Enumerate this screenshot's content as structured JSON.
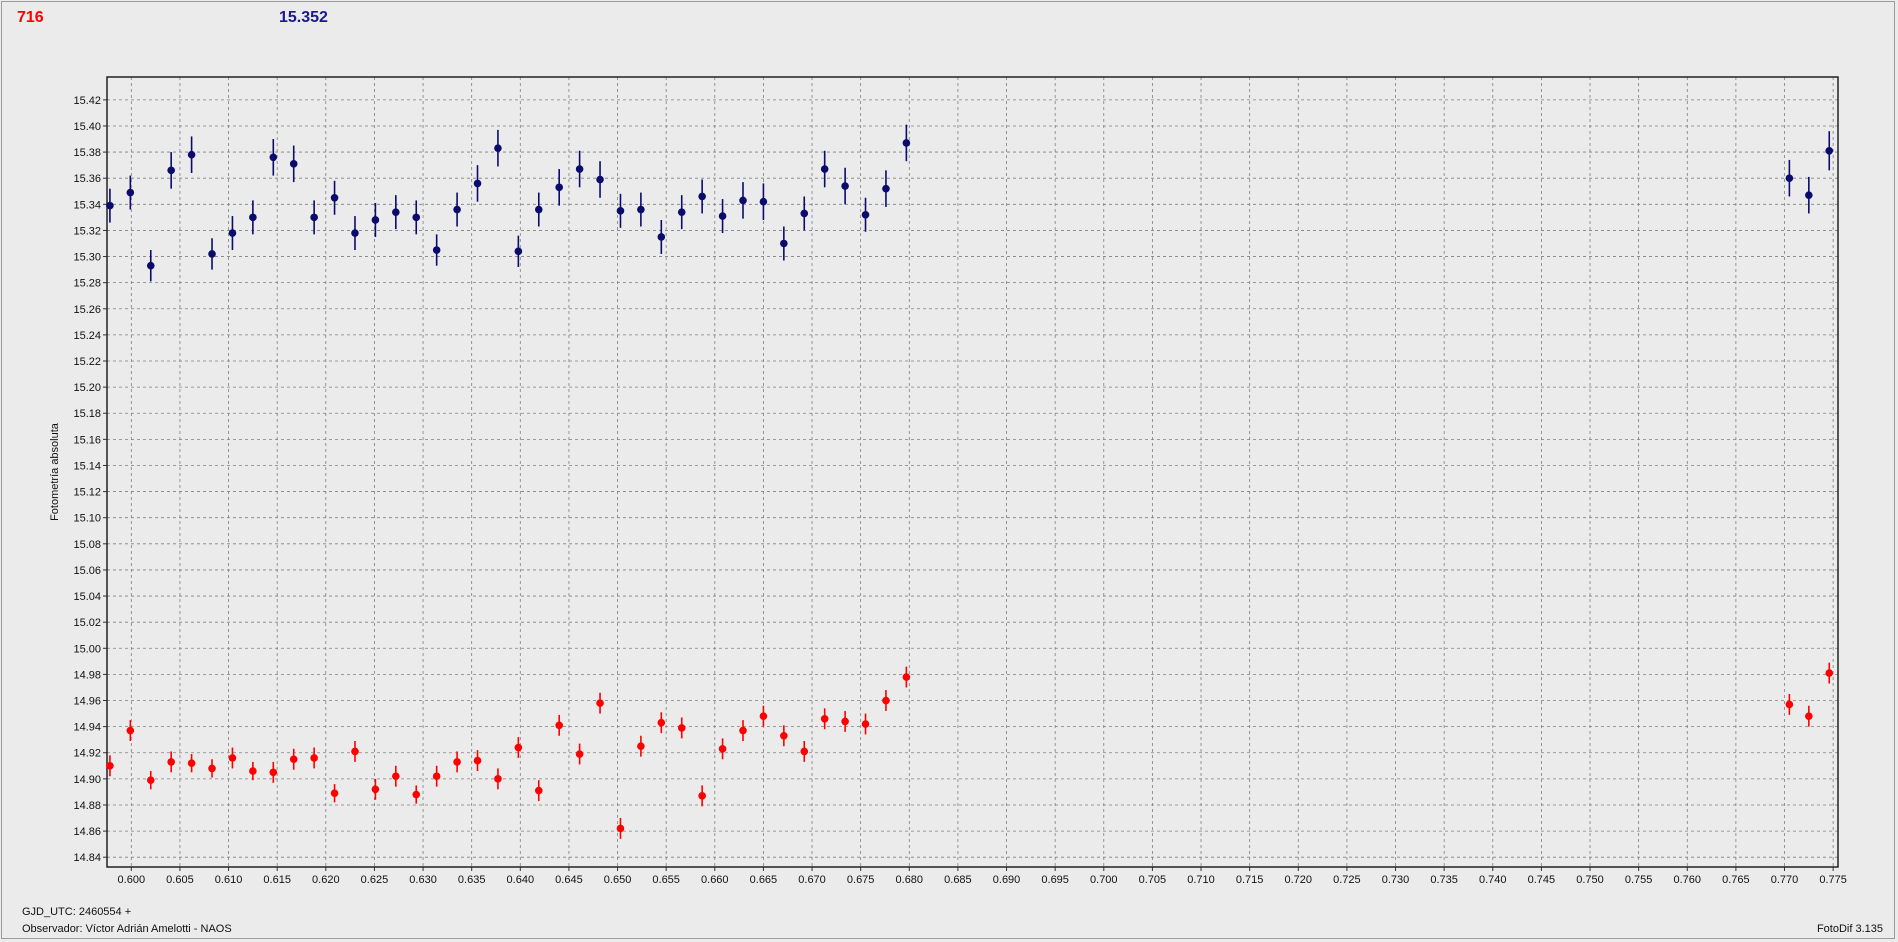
{
  "header": {
    "left_value": "716",
    "mid_value": "15.352"
  },
  "footer": {
    "gjd": "GJD_UTC: 2460554 +",
    "observer": "Observador: Víctor Adrián Amelotti - NAOS",
    "software": "FotoDif 3.135"
  },
  "colors": {
    "series_red": "#ff0000",
    "series_blue": "#0b0b6e",
    "grid": "#7f7f7f",
    "background": "#ebebeb"
  },
  "chart_data": {
    "type": "scatter",
    "ylabel": "Fotometría absoluta",
    "xlabel": "",
    "xlim": [
      0.5975,
      0.7755
    ],
    "ylim": [
      15.4375,
      14.8325
    ],
    "y_inverted": true,
    "grid": true,
    "error_bars": true,
    "x_ticks": [
      "0.600",
      "0.605",
      "0.610",
      "0.615",
      "0.620",
      "0.625",
      "0.630",
      "0.635",
      "0.640",
      "0.645",
      "0.650",
      "0.655",
      "0.660",
      "0.665",
      "0.670",
      "0.675",
      "0.680",
      "0.685",
      "0.690",
      "0.695",
      "0.700",
      "0.705",
      "0.710",
      "0.715",
      "0.720",
      "0.725",
      "0.730",
      "0.735",
      "0.740",
      "0.745",
      "0.750",
      "0.755",
      "0.760",
      "0.765",
      "0.770",
      "0.775"
    ],
    "y_ticks": [
      "14.84",
      "14.86",
      "14.88",
      "14.90",
      "14.92",
      "14.94",
      "14.96",
      "14.98",
      "15.00",
      "15.02",
      "15.04",
      "15.06",
      "15.08",
      "15.10",
      "15.12",
      "15.14",
      "15.16",
      "15.18",
      "15.20",
      "15.22",
      "15.24",
      "15.26",
      "15.28",
      "15.30",
      "15.32",
      "15.34",
      "15.36",
      "15.38",
      "15.40",
      "15.42"
    ],
    "series": [
      {
        "color": "#ff0000",
        "x": [
          0.5978,
          0.5999,
          0.602,
          0.6041,
          0.6062,
          0.6083,
          0.6104,
          0.6125,
          0.6146,
          0.6167,
          0.6188,
          0.6209,
          0.623,
          0.6251,
          0.6272,
          0.6293,
          0.6314,
          0.6335,
          0.6356,
          0.6377,
          0.6398,
          0.6419,
          0.644,
          0.6461,
          0.6482,
          0.6503,
          0.6524,
          0.6545,
          0.6566,
          0.6587,
          0.6608,
          0.6629,
          0.665,
          0.6671,
          0.6692,
          0.6713,
          0.6734,
          0.6755,
          0.6776,
          0.6797,
          0.7705,
          0.7725,
          0.7746
        ],
        "y": [
          14.91,
          14.937,
          14.899,
          14.913,
          14.912,
          14.908,
          14.916,
          14.906,
          14.905,
          14.915,
          14.916,
          14.889,
          14.921,
          14.892,
          14.902,
          14.888,
          14.902,
          14.913,
          14.914,
          14.9,
          14.924,
          14.891,
          14.941,
          14.919,
          14.958,
          14.862,
          14.925,
          14.943,
          14.939,
          14.887,
          14.923,
          14.937,
          14.948,
          14.933,
          14.921,
          14.946,
          14.944,
          14.942,
          14.96,
          14.978,
          14.957,
          14.948,
          14.981
        ],
        "err": [
          0.008,
          0.008,
          0.007,
          0.008,
          0.007,
          0.007,
          0.008,
          0.007,
          0.008,
          0.008,
          0.008,
          0.007,
          0.008,
          0.008,
          0.008,
          0.007,
          0.008,
          0.008,
          0.008,
          0.008,
          0.008,
          0.008,
          0.008,
          0.008,
          0.008,
          0.008,
          0.008,
          0.008,
          0.008,
          0.008,
          0.008,
          0.008,
          0.008,
          0.008,
          0.008,
          0.008,
          0.008,
          0.008,
          0.008,
          0.008,
          0.008,
          0.008,
          0.008
        ]
      },
      {
        "color": "#0b0b6e",
        "x": [
          0.5978,
          0.5999,
          0.602,
          0.6041,
          0.6062,
          0.6083,
          0.6104,
          0.6125,
          0.6146,
          0.6167,
          0.6188,
          0.6209,
          0.623,
          0.6251,
          0.6272,
          0.6293,
          0.6314,
          0.6335,
          0.6356,
          0.6377,
          0.6398,
          0.6419,
          0.644,
          0.6461,
          0.6482,
          0.6503,
          0.6524,
          0.6545,
          0.6566,
          0.6587,
          0.6608,
          0.6629,
          0.665,
          0.6671,
          0.6692,
          0.6713,
          0.6734,
          0.6755,
          0.6776,
          0.6797,
          0.7705,
          0.7725,
          0.7746
        ],
        "y": [
          15.339,
          15.349,
          15.293,
          15.366,
          15.378,
          15.302,
          15.318,
          15.33,
          15.376,
          15.371,
          15.33,
          15.345,
          15.318,
          15.328,
          15.334,
          15.33,
          15.305,
          15.336,
          15.356,
          15.383,
          15.304,
          15.336,
          15.353,
          15.367,
          15.359,
          15.335,
          15.336,
          15.315,
          15.334,
          15.346,
          15.331,
          15.343,
          15.342,
          15.31,
          15.333,
          15.367,
          15.354,
          15.332,
          15.352,
          15.387,
          15.36,
          15.347,
          15.381
        ],
        "err": [
          0.013,
          0.013,
          0.012,
          0.014,
          0.014,
          0.012,
          0.013,
          0.013,
          0.014,
          0.014,
          0.013,
          0.013,
          0.013,
          0.013,
          0.013,
          0.013,
          0.012,
          0.013,
          0.014,
          0.014,
          0.012,
          0.013,
          0.014,
          0.014,
          0.014,
          0.013,
          0.013,
          0.013,
          0.013,
          0.013,
          0.013,
          0.014,
          0.014,
          0.013,
          0.013,
          0.014,
          0.014,
          0.013,
          0.014,
          0.014,
          0.014,
          0.014,
          0.015
        ]
      }
    ]
  }
}
